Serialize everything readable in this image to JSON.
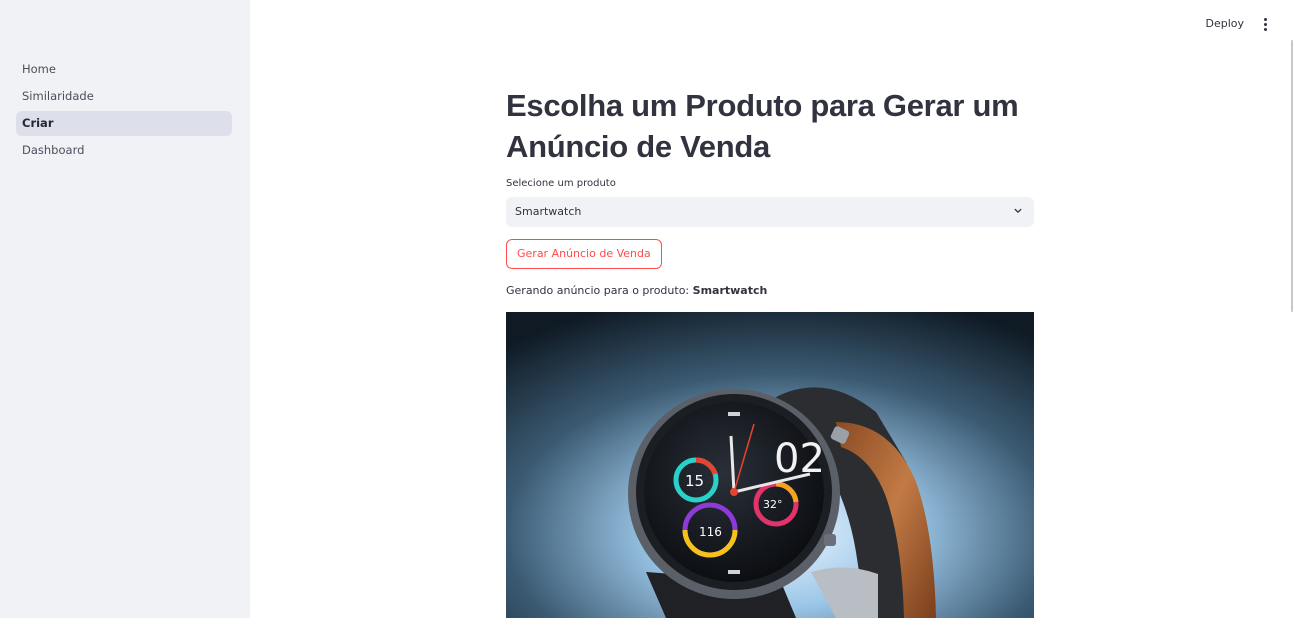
{
  "sidebar": {
    "items": [
      {
        "label": "Home",
        "active": false
      },
      {
        "label": "Similaridade",
        "active": false
      },
      {
        "label": "Criar",
        "active": true
      },
      {
        "label": "Dashboard",
        "active": false
      }
    ]
  },
  "header": {
    "deploy_label": "Deploy",
    "menu_icon": "more-vertical-icon"
  },
  "main": {
    "title": "Escolha um Produto para Gerar um Anúncio de Venda",
    "select": {
      "label": "Selecione um produto",
      "value": "Smartwatch",
      "icon": "chevron-down-icon"
    },
    "button_label": "Gerar Anúncio de Venda",
    "status_prefix": "Gerando anúncio para o produto:",
    "status_product": "Smartwatch",
    "image": {
      "subject": "smartwatch",
      "watch_face_texts": [
        "02",
        "15",
        "32°",
        "116"
      ]
    }
  },
  "colors": {
    "primary": "#ff4b4b",
    "sidebar_bg": "#f0f2f6",
    "text": "#31333f"
  }
}
